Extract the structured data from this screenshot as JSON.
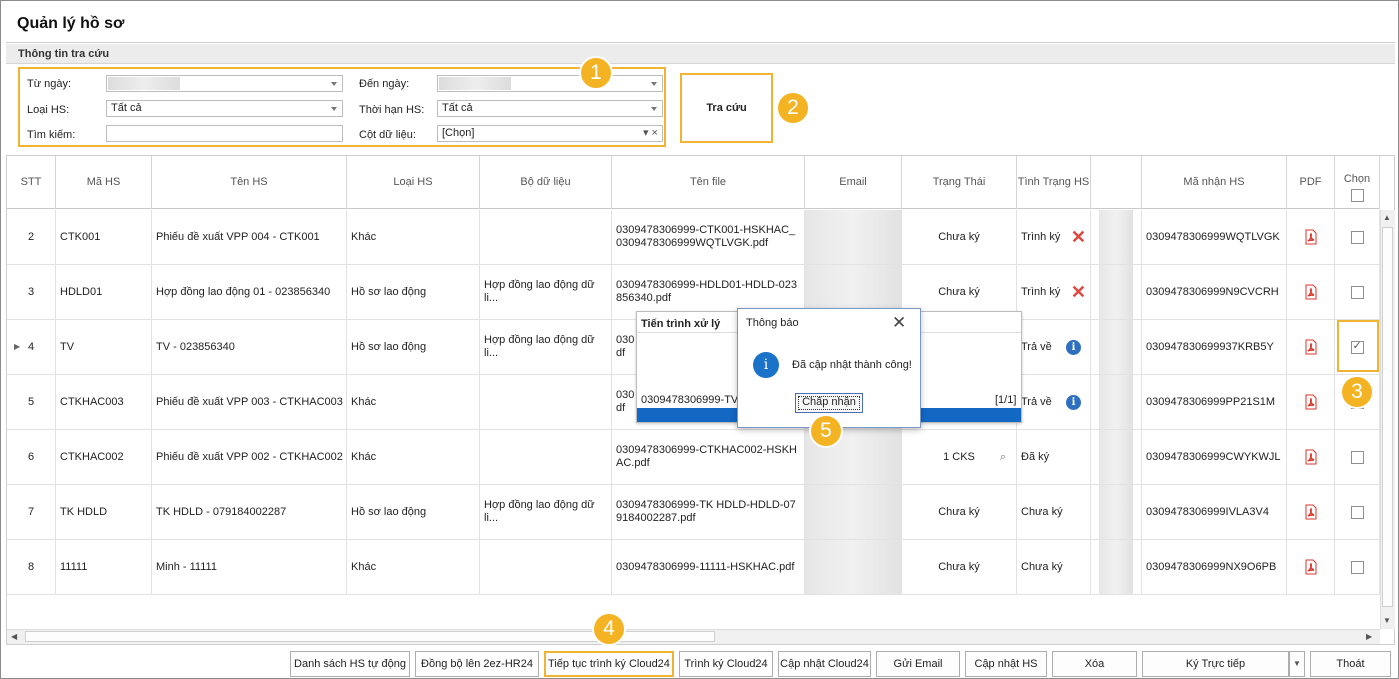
{
  "window": {
    "title": "Quản lý hồ sơ"
  },
  "filter": {
    "group_title": "Thông tin tra cứu",
    "from_label": "Từ ngày:",
    "to_label": "Đến ngày:",
    "type_label": "Loại HS:",
    "type_value": "Tất cả",
    "term_label": "Thời hạn HS:",
    "term_value": "Tất cả",
    "search_label": "Tìm kiếm:",
    "search_value": "",
    "column_label": "Cột dữ liệu:",
    "column_value": "[Chọn]",
    "search_button": "Tra cứu"
  },
  "badges": [
    "1",
    "2",
    "3",
    "4",
    "5"
  ],
  "grid": {
    "columns": [
      "STT",
      "Mã HS",
      "Tên HS",
      "Loại HS",
      "Bộ dữ liệu",
      "Tên file",
      "Email",
      "Trạng Thái",
      "Tình Trạng HS",
      "",
      "Mã nhận HS",
      "PDF",
      "Chọn"
    ],
    "rows": [
      {
        "stt": "2",
        "ma": "CTK001",
        "ten": "Phiếu đề xuất VPP 004 - CTK001",
        "loai": "Khác",
        "bo": "",
        "file": "0309478306999-CTK001-HSKHAC_0309478306999WQTLVGK.pdf",
        "trangthai": "Chưa ký",
        "tinhtrang": "Trình ký",
        "status_icon": "close-icon",
        "manhan": "0309478306999WQTLVGK",
        "chon": false
      },
      {
        "stt": "3",
        "ma": "HDLD01",
        "ten": "Hợp đồng lao động 01 - 023856340",
        "loai": "Hồ sơ lao động",
        "bo": "Hợp đồng lao động dữ li...",
        "file": "0309478306999-HDLD01-HDLD-023856340.pdf",
        "trangthai": "Chưa ký",
        "tinhtrang": "Trình ký",
        "status_icon": "close-icon",
        "manhan": "0309478306999N9CVCRH",
        "chon": false
      },
      {
        "stt": "4",
        "ma": "TV",
        "ten": "TV - 023856340",
        "loai": "Hồ sơ lao động",
        "bo": "Hợp đồng lao động dữ li...",
        "file": "030",
        "file2": "df",
        "trangthai": "",
        "tinhtrang": "Trả về",
        "status_icon": "info-icon",
        "manhan": "030947830699937KRB5Y",
        "chon": true
      },
      {
        "stt": "5",
        "ma": "CTKHAC003",
        "ten": "Phiếu đề xuất VPP 003 - CTKHAC003",
        "loai": "Khác",
        "bo": "",
        "file": "030",
        "file2": "df",
        "trangthai": "",
        "tinhtrang": "Trả về",
        "status_icon": "info-icon",
        "manhan": "0309478306999PP21S1M",
        "chon": false
      },
      {
        "stt": "6",
        "ma": "CTKHAC002",
        "ten": "Phiếu đề xuất VPP 002 - CTKHAC002",
        "loai": "Khác",
        "bo": "",
        "file": "0309478306999-CTKHAC002-HSKHAC.pdf",
        "trangthai": "1 CKS",
        "tinhtrang": "Đã ký",
        "status_icon": "",
        "manhan": "0309478306999CWYKWJL",
        "chon": false
      },
      {
        "stt": "7",
        "ma": "TK HDLD",
        "ten": "TK HDLD - 079184002287",
        "loai": "Hồ sơ lao động",
        "bo": "Hợp đồng lao động dữ li...",
        "file": "0309478306999-TK HDLD-HDLD-079184002287.pdf",
        "trangthai": "Chưa ký",
        "tinhtrang": "Chưa ký",
        "status_icon": "",
        "manhan": "0309478306999IVLA3V4",
        "chon": false
      },
      {
        "stt": "8",
        "ma": "11111",
        "ten": "Minh - 11111",
        "loai": "Khác",
        "bo": "",
        "file": "0309478306999-11111-HSKHAC.pdf",
        "trangthai": "Chưa ký",
        "tinhtrang": "Chưa ký",
        "status_icon": "",
        "manhan": "0309478306999NX9O6PB",
        "chon": false
      }
    ]
  },
  "progress": {
    "title": "Tiến trình xử lý",
    "file": "0309478306999-TV-H",
    "count": "[1/1]",
    "fraction": 1.0
  },
  "message": {
    "title": "Thông báo",
    "text": "Đã cập nhật thành công!",
    "ok": "Chấp nhận"
  },
  "buttons": [
    "Danh sách HS tự động",
    "Đồng bộ lên 2ez-HR24",
    "Tiếp tục trình ký Cloud24",
    "Trình ký Cloud24",
    "Cập nhật Cloud24",
    "Gửi Email",
    "Cập nhật HS",
    "Xóa",
    "Ký Trực tiếp",
    "Thoát"
  ],
  "colors": {
    "accent": "#f4b322",
    "progress": "#1368c4",
    "pdf": "#d9362b",
    "error": "#e0463e",
    "info": "#2f6fc2"
  }
}
